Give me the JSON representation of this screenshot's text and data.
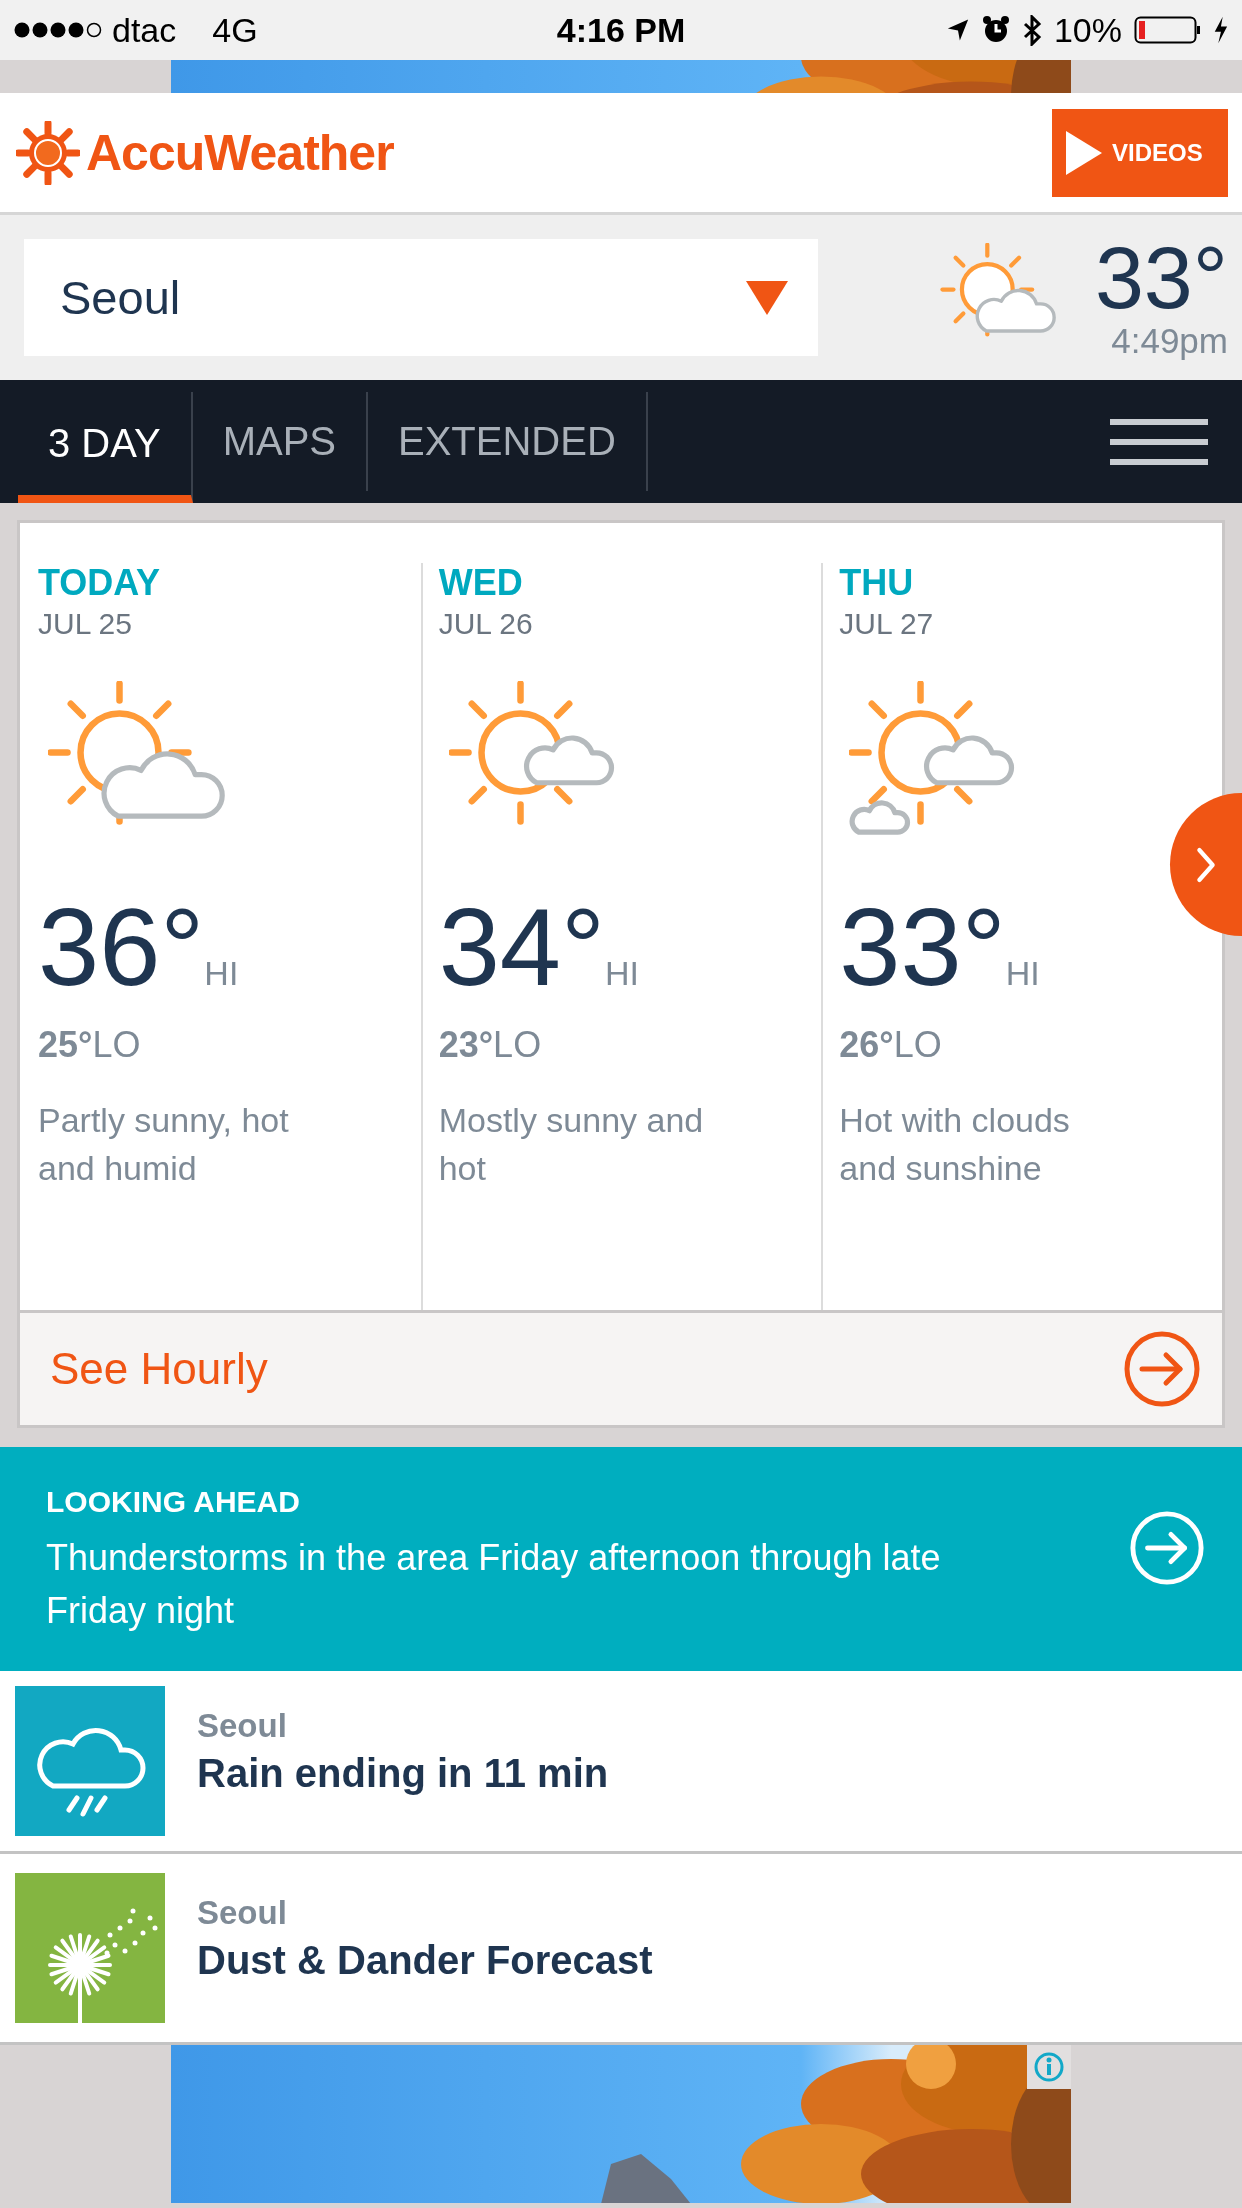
{
  "status_bar": {
    "carrier": "dtac",
    "network": "4G",
    "time": "4:16 PM",
    "battery": "10%"
  },
  "header": {
    "logo": "AccuWeather",
    "videos_button": "VIDEOS"
  },
  "location": {
    "city": "Seoul",
    "temperature": "33°",
    "time": "4:49pm"
  },
  "tabs": [
    {
      "label": "3 DAY",
      "selected": true
    },
    {
      "label": "MAPS",
      "selected": false
    },
    {
      "label": "EXTENDED",
      "selected": false
    }
  ],
  "forecast": {
    "days": [
      {
        "kind": "partly_sunny",
        "day": "TODAY",
        "date": "JUL 25",
        "hi": "36°",
        "hi_label": "HI",
        "lo": "25°",
        "lo_label": "LO",
        "phrase": "Partly sunny, hot and humid"
      },
      {
        "kind": "mostly_sunny",
        "day": "WED",
        "date": "JUL 26",
        "hi": "34°",
        "hi_label": "HI",
        "lo": "23°",
        "lo_label": "LO",
        "phrase": "Mostly sunny and hot"
      },
      {
        "kind": "hot_clouds",
        "day": "THU",
        "date": "JUL 27",
        "hi": "33°",
        "hi_label": "HI",
        "lo": "26°",
        "lo_label": "LO",
        "phrase": "Hot with clouds and sunshine"
      }
    ],
    "see_hourly": "See Hourly"
  },
  "looking_ahead": {
    "heading": "LOOKING AHEAD",
    "text": "Thunderstorms in the area Friday afternoon through late Friday night"
  },
  "cards": [
    {
      "kind": "rain",
      "location": "Seoul",
      "title": "Rain ending in 11 min"
    },
    {
      "kind": "dandelion",
      "location": "Seoul",
      "title": "Dust & Dander Forecast"
    }
  ]
}
